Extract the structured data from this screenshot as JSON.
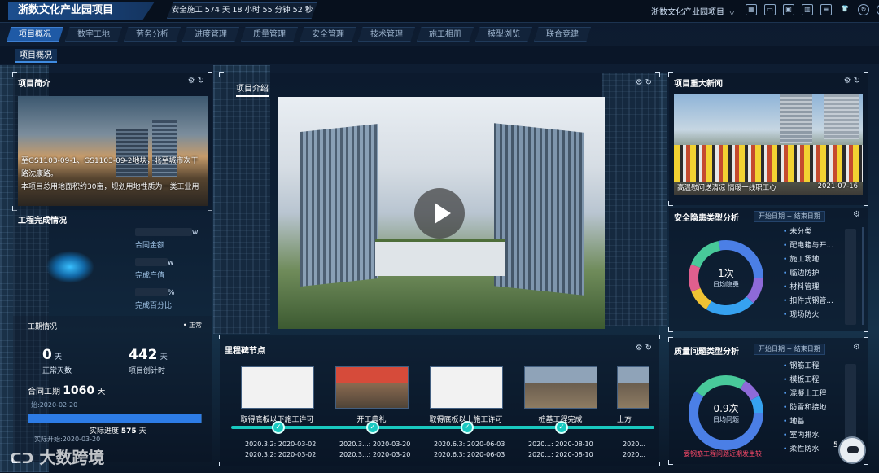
{
  "header": {
    "project_title": "浙数文化产业园项目",
    "safety_text": "安全施工 574 天 18 小时 55 分钟 52 秒",
    "project_select": "浙数文化产业园项目",
    "tool_icons": [
      "grid-icon",
      "monitor-icon",
      "screen-icon",
      "chart-icon",
      "doc-icon",
      "shirt-icon",
      "refresh-icon",
      "settings-icon"
    ]
  },
  "nav": {
    "tabs": [
      "项目概况",
      "数字工地",
      "劳务分析",
      "进度管理",
      "质量管理",
      "安全管理",
      "技术管理",
      "施工相册",
      "模型浏览",
      "联合竞建"
    ],
    "active_index": 0,
    "sub_tab": "项目概况"
  },
  "intro_panel": {
    "title": "项目简介",
    "line1": "至GS1103-09-1、GS1103-09-2地块，北至城市次干",
    "line2": "路沈康路。",
    "line3": "本项目总用地面积约30亩，规划用地性质为一类工业用"
  },
  "completion_panel": {
    "title": "工程完成情况",
    "contract_amount_unit": "w",
    "contract_amount_label": "合同金额",
    "output_unit": "w",
    "output_label": "完成产值",
    "percent_unit": "%",
    "percent_label": "完成百分比"
  },
  "schedule_panel": {
    "title": "工期情况",
    "status": "正常",
    "normal_days": "0",
    "normal_days_unit": "天",
    "normal_days_label": "正常天数",
    "created_days": "442",
    "created_days_unit": "天",
    "created_days_label": "项目创计时",
    "contract_label": "合同工期",
    "contract_days": "1060",
    "contract_unit": "天",
    "start_note": "始:2020-02-20",
    "actual_progress_label": "实际进度",
    "actual_progress_days": "575",
    "actual_progress_unit": "天",
    "actual_start": "实际开始:2020-03-20",
    "progress_fraction": 1.0
  },
  "video_panel": {
    "tab_label": "项目介绍"
  },
  "news_panel": {
    "title": "项目重大新闻",
    "caption": "高温慰问送清凉 情暖一线职工心",
    "date": "2021-07-16"
  },
  "safety_analysis": {
    "title": "安全隐患类型分析",
    "start_date": "开始日期",
    "sep": "~",
    "end_date": "结束日期",
    "center_value": "1次",
    "center_label": "日均隐患",
    "items": [
      "未分类",
      "配电箱与开...",
      "施工场地",
      "临边防护",
      "材料管理",
      "扣件式钢管...",
      "现场防火"
    ]
  },
  "quality_analysis": {
    "title": "质量问题类型分析",
    "start_date": "开始日期",
    "sep": "~",
    "end_date": "结束日期",
    "center_value": "0.9次",
    "center_label": "日均问题",
    "items": [
      "钢筋工程",
      "模板工程",
      "混凝土工程",
      "防雷和接地",
      "地基",
      "室内排水",
      "柔性防水"
    ],
    "warning": "要钢筋工程问题近期发生较"
  },
  "milestone_panel": {
    "title": "里程碑节点",
    "items": [
      {
        "label": "取得底板以下施工许可",
        "date1": "2020.3.2: 2020-03-02",
        "date2": "2020.3.2: 2020-03-02",
        "kind": "doc"
      },
      {
        "label": "开工典礼",
        "date1": "2020.3...: 2020-03-20",
        "date2": "2020.3...: 2020-03-20",
        "kind": "event"
      },
      {
        "label": "取得底板以上施工许可",
        "date1": "2020.6.3: 2020-06-03",
        "date2": "2020.6.3: 2020-06-03",
        "kind": "doc"
      },
      {
        "label": "桩基工程完成",
        "date1": "2020...: 2020-08-10",
        "date2": "2020...: 2020-08-10",
        "kind": "site"
      },
      {
        "label": "土方",
        "date1": "2020...",
        "date2": "2020...",
        "kind": "site"
      }
    ]
  },
  "footer": {
    "watermark": "大数跨境",
    "bot_count": "5"
  },
  "colors": {
    "accent": "#1f5aa6",
    "teal": "#19c9c0",
    "progress": "#2d7ce6"
  }
}
